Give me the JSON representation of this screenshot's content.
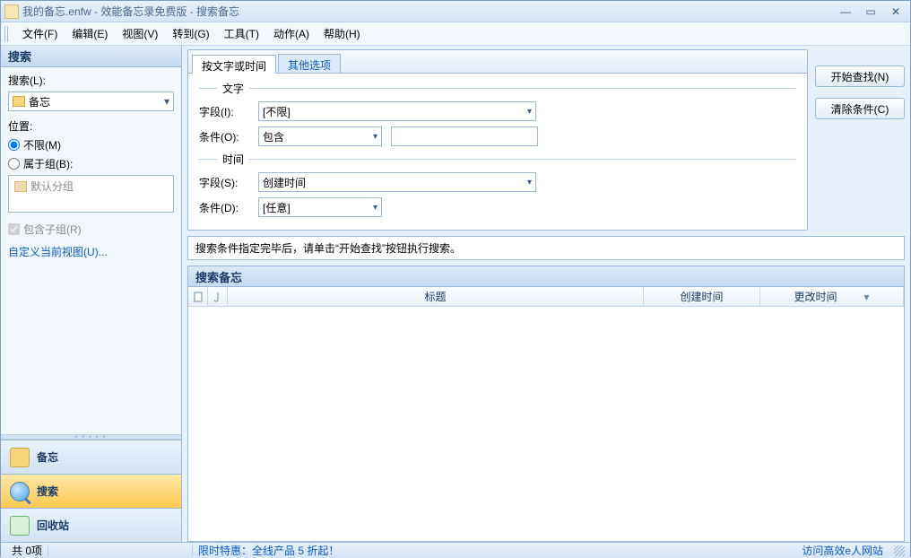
{
  "window": {
    "title": "我的备忘.enfw - 效能备忘录免费版 - 搜索备忘"
  },
  "menu": {
    "file": "文件(F)",
    "edit": "编辑(E)",
    "view": "视图(V)",
    "goto": "转到(G)",
    "tools": "工具(T)",
    "action": "动作(A)",
    "help": "帮助(H)"
  },
  "sidebar": {
    "title": "搜索",
    "search_label": "搜索(L):",
    "search_value": "备忘",
    "location_label": "位置:",
    "radio_unlimited": "不限(M)",
    "radio_group": "属于组(B):",
    "default_group": "默认分组",
    "include_sub": "包含子组(R)",
    "customize_link": "自定义当前视图(U)...",
    "nav": {
      "memo": "备忘",
      "search": "搜索",
      "recycle": "回收站"
    }
  },
  "tabs": {
    "bytext": "按文字或时间",
    "other": "其他选项"
  },
  "form": {
    "text_section": "文字",
    "field_i": "字段(I):",
    "field_i_val": "[不限]",
    "cond_o": "条件(O):",
    "cond_o_val": "包含",
    "keyword_val": "",
    "time_section": "时间",
    "field_s": "字段(S):",
    "field_s_val": "创建时间",
    "cond_d": "条件(D):",
    "cond_d_val": "[任意]"
  },
  "buttons": {
    "start": "开始查找(N)",
    "clear": "清除条件(C)"
  },
  "hint": "搜索条件指定完毕后，请单击“开始查找”按钮执行搜索。",
  "results": {
    "title": "搜索备忘",
    "cols": {
      "title": "标题",
      "created": "创建时间",
      "modified": "更改时间"
    }
  },
  "status": {
    "count": "共 0项",
    "promo": "限时特惠：全线产品 5 折起！",
    "visit": "访问高效e人网站"
  }
}
